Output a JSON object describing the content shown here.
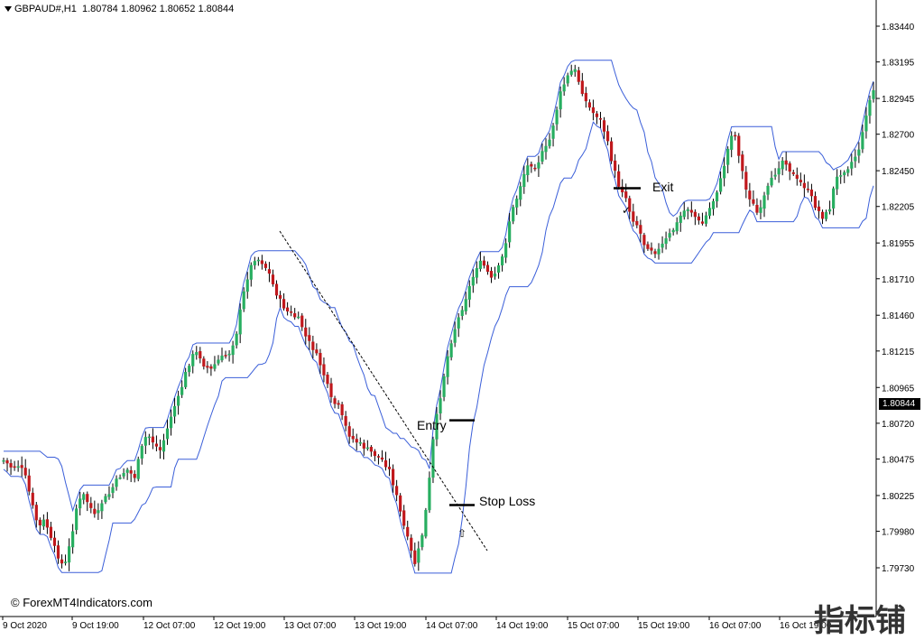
{
  "header": {
    "symbol": "GBPAUD#,H1",
    "ohlc": "1.80784 1.80962 1.80652 1.80844"
  },
  "current_price": "1.80844",
  "copyright": "© ForexMT4Indicators.com",
  "watermark": "指标铺",
  "annotations": {
    "entry": "Entry",
    "stop_loss": "Stop Loss",
    "exit": "Exit",
    "check": "✓",
    "arrow": "⇧"
  },
  "colors": {
    "bull": "#27ae60",
    "bear": "#c0181c",
    "channel": "#3b5fd9",
    "trend": "#000000",
    "axis": "#000000"
  },
  "chart_data": {
    "type": "candlestick",
    "y_axis": {
      "min": 1.7973,
      "max": 1.8344,
      "ticks": [
        "1.83440",
        "1.83195",
        "1.82945",
        "1.82700",
        "1.82450",
        "1.82205",
        "1.81955",
        "1.81710",
        "1.81460",
        "1.81215",
        "1.80965",
        "1.80720",
        "1.80475",
        "1.80225",
        "1.79980",
        "1.79730"
      ]
    },
    "x_axis": {
      "ticks": [
        "9 Oct 2020",
        "9 Oct 19:00",
        "12 Oct 07:00",
        "12 Oct 19:00",
        "13 Oct 07:00",
        "13 Oct 19:00",
        "14 Oct 07:00",
        "14 Oct 19:00",
        "15 Oct 07:00",
        "15 Oct 19:00",
        "16 Oct 07:00",
        "16 Oct 19:00"
      ]
    },
    "indicator": "Donchian-style price channel (upper/lower band)",
    "trades": [
      {
        "label": "Entry",
        "price": 1.8074
      },
      {
        "label": "Stop Loss",
        "price": 1.8016
      },
      {
        "label": "Exit",
        "price": 1.8233
      }
    ]
  }
}
